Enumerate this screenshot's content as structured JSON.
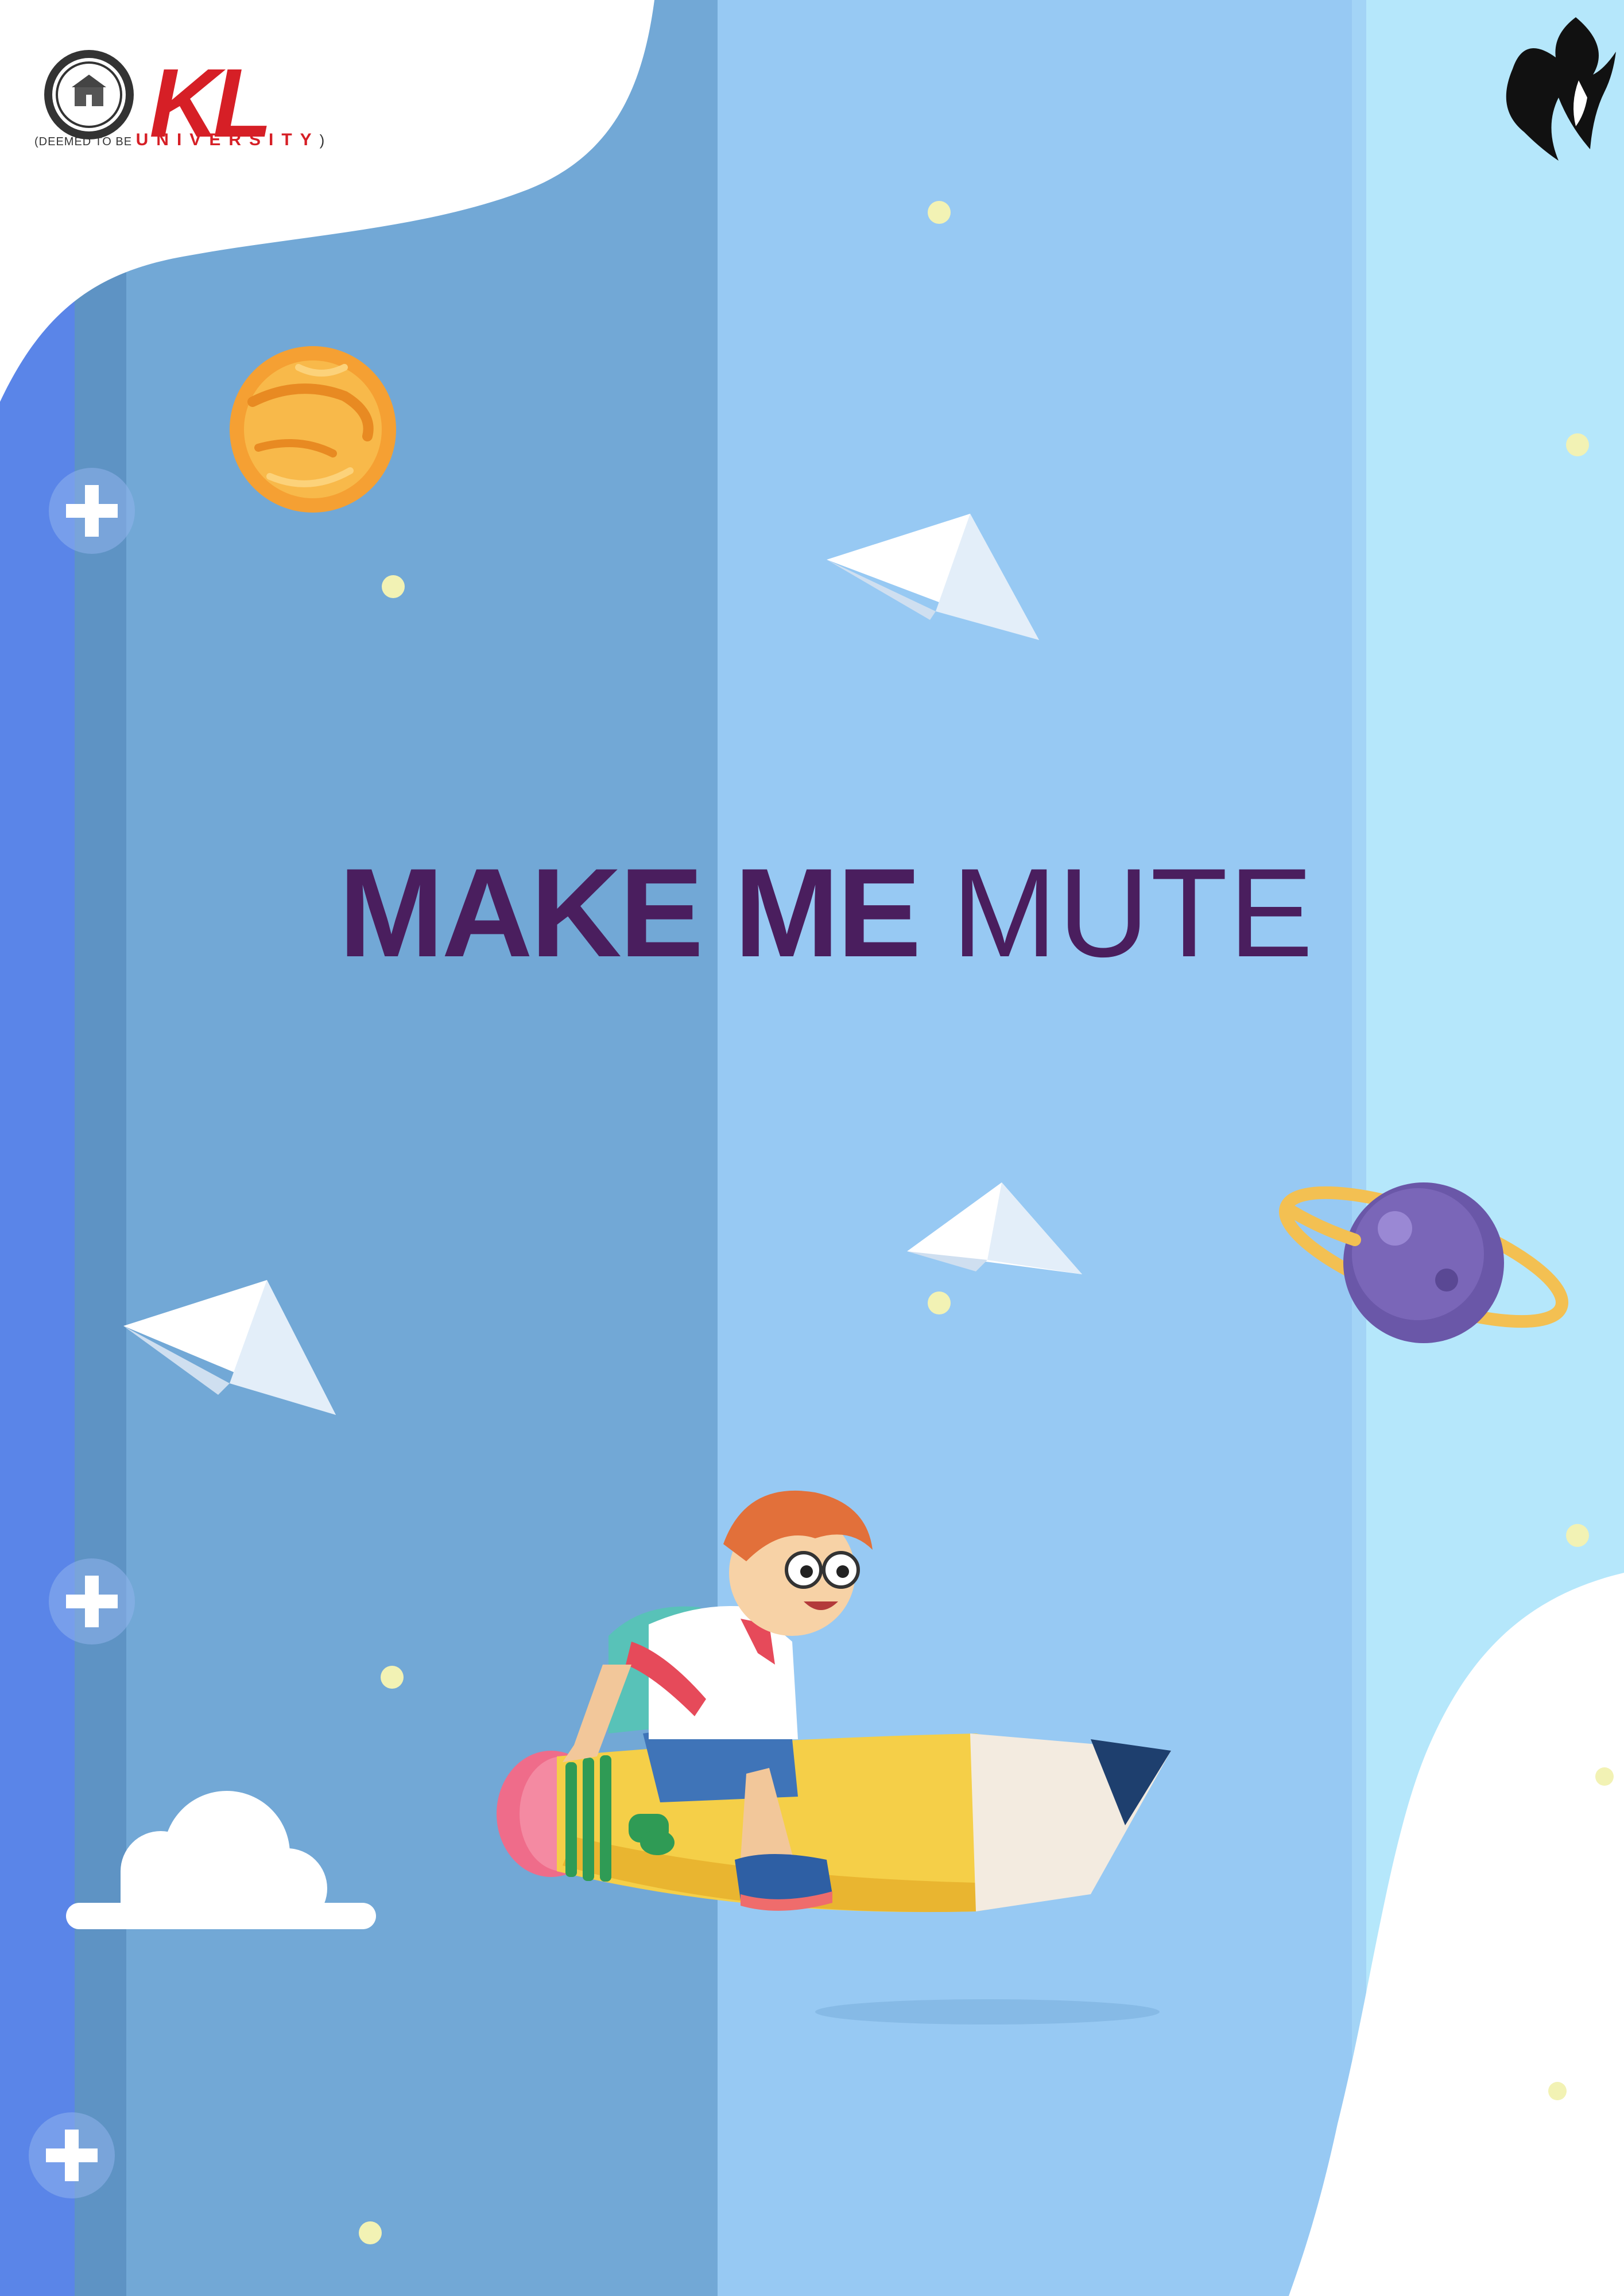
{
  "poster": {
    "title_bold": "MAKE ME ",
    "title_light": "MUTE"
  },
  "logo": {
    "letters": "KL",
    "sub_small": "(DEEMED TO BE ",
    "sub_big": "UNIVERSITY",
    "sub_close": ")"
  },
  "colors": {
    "title": "#4a1e5e",
    "brand_red": "#d61f26",
    "band_dark": "#72a8d6",
    "band_mid": "#97c9f3",
    "band_light": "#b5e7fb",
    "strip_blue": "#5a85e8"
  },
  "icons": [
    "university-emblem-icon",
    "flame-face-icon",
    "planet-icon",
    "ringed-planet-icon",
    "paper-plane-icon",
    "plus-sparkle-icon",
    "cloud-icon",
    "boy-on-pencil-illustration"
  ]
}
